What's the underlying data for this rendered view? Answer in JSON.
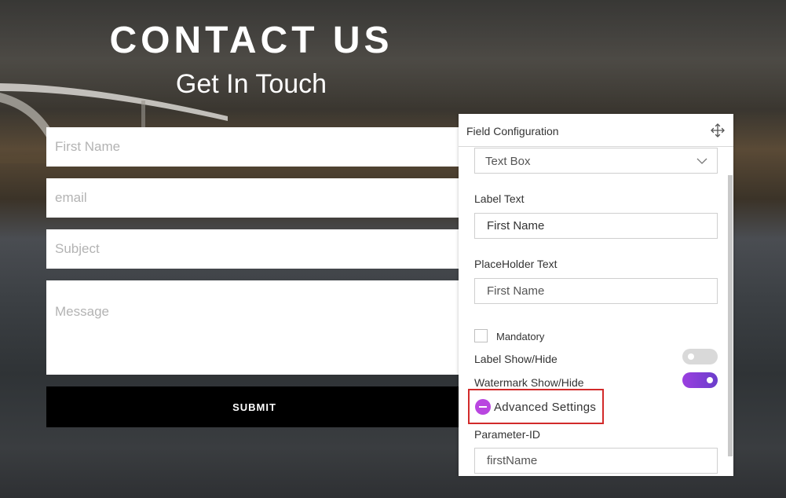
{
  "hero": {
    "title": "CONTACT US",
    "subtitle": "Get In Touch"
  },
  "contact_form": {
    "first_name_placeholder": "First Name",
    "email_placeholder": "email",
    "subject_placeholder": "Subject",
    "message_placeholder": "Message",
    "submit_label": "SUBMIT"
  },
  "field_config": {
    "title": "Field Configuration",
    "move_icon": "move-arrows-icon",
    "field_type": "Text Box",
    "label_text_label": "Label Text",
    "label_text_value": "First Name",
    "placeholder_text_label": "PlaceHolder Text",
    "placeholder_text_value": "First Name",
    "mandatory_label": "Mandatory",
    "mandatory_checked": false,
    "label_show_hide_label": "Label Show/Hide",
    "label_show_hide_on": false,
    "watermark_show_hide_label": "Watermark Show/Hide",
    "watermark_show_hide_on": true,
    "advanced_settings_label": "Advanced Settings",
    "parameter_id_label": "Parameter-ID",
    "parameter_id_value": "firstName"
  },
  "colors": {
    "toggle_off": "#d9d9d9",
    "toggle_on": "#8a3fd6",
    "advanced_icon": "#b946e0",
    "highlight_border": "#d22a2a"
  }
}
